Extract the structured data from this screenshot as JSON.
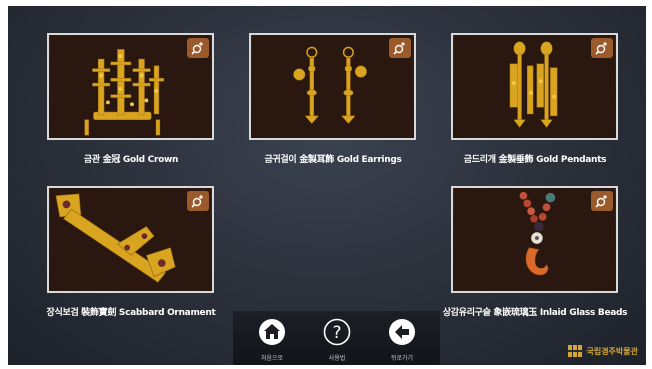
{
  "items": [
    {
      "caption": "금관 金冠 Gold Crown",
      "icon": "zoom-in-icon"
    },
    {
      "caption": "금귀걸이 金製耳飾 Gold Earrings",
      "icon": "zoom-in-icon"
    },
    {
      "caption": "금드리개 金製垂飾 Gold Pendants",
      "icon": "zoom-in-icon"
    },
    {
      "caption": "장식보검 裝飾寶劍 Scabbard Ornament",
      "icon": "zoom-in-icon"
    },
    {
      "caption": "상감유리구슬 象嵌琉璃玉 Inlaid Glass Beads",
      "icon": "zoom-in-icon"
    }
  ],
  "nav": {
    "home_label": "처음으로",
    "help_label": "사용법",
    "back_label": "뒤로가기"
  },
  "logo": {
    "text": "국립경주박물관"
  },
  "colors": {
    "accent": "#9a5a2c",
    "logo": "#d4a63a",
    "background": "#2a2f39"
  }
}
